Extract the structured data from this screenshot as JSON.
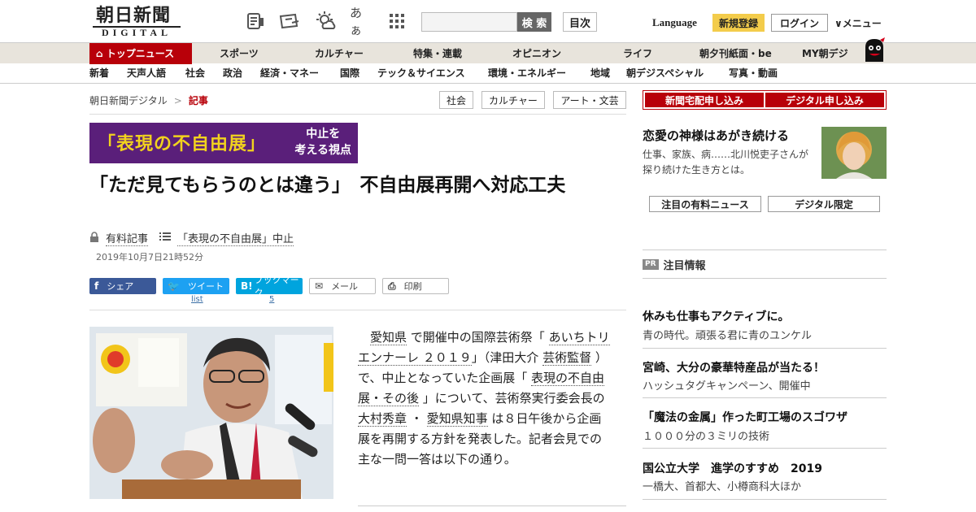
{
  "header": {
    "logo_main": "朝日新聞",
    "logo_sub": "DIGITAL",
    "icons": [
      "newspaper-icon",
      "tablet-icon",
      "weather-icon",
      "font-size-icon",
      "apps-grid-icon"
    ],
    "font_size_glyph": "あぁ",
    "search_placeholder": "",
    "search_button": "検 索",
    "toc_button": "目次",
    "language": "Language",
    "register": "新規登録",
    "login": "ログイン",
    "menu": "メニュー"
  },
  "nav_primary": [
    "トップニュース",
    "スポーツ",
    "カルチャー",
    "特集・連載",
    "オピニオン",
    "ライフ",
    "朝夕刊紙面・be",
    "MY朝デジ"
  ],
  "nav_secondary": [
    "新着",
    "天声人語",
    "社会",
    "政治",
    "経済・マネー",
    "国際",
    "テック＆サイエンス",
    "環境・エネルギー",
    "地域",
    "朝デジスペシャル",
    "写真・動画"
  ],
  "breadcrumb": {
    "home": "朝日新聞デジタル",
    "separator": ">",
    "current": "記事"
  },
  "tags": [
    "社会",
    "カルチャー",
    "アート・文芸"
  ],
  "banner": {
    "title": "「表現の不自由展」",
    "side": [
      "中止を",
      "考える視点"
    ]
  },
  "article": {
    "headline": "「ただ見てもらうのとは違う」　不自由展再開へ対応工夫",
    "paid": "有料記事",
    "series": "「表現の不自由展」中止",
    "date": "2019年10月7日21時52分",
    "body": [
      {
        "t": "愛知県",
        "link": true
      },
      {
        "t": " で開催中の国際芸術祭「 ",
        "link": false
      },
      {
        "t": "あいちトリエンナーレ ２０１９",
        "link": true
      },
      {
        "t": "」（津田大介 ",
        "link": false
      },
      {
        "t": "芸術監督",
        "link": true
      },
      {
        "t": " ）で、中止となっていた企画展「 ",
        "link": false
      },
      {
        "t": "表現の不自由展・その後",
        "link": true
      },
      {
        "t": " 」について、芸術祭実行委会長の ",
        "link": false
      },
      {
        "t": "大村秀章",
        "link": true
      },
      {
        "t": " ・ ",
        "link": false
      },
      {
        "t": "愛知県知事",
        "link": true
      },
      {
        "t": " は８日午後から企画展を再開する方針を発表した。記者会見での主な一問一答は以下の通り。",
        "link": false
      }
    ]
  },
  "share": {
    "facebook": "シェア",
    "twitter": "ツイート",
    "hatena": "ブックマーク",
    "mail": "メール",
    "print": "印刷",
    "twitter_count": "list",
    "hatena_count": "5"
  },
  "sidebar": {
    "subscribe": [
      "新聞宅配申し込み",
      "デジタル申し込み"
    ],
    "feature": {
      "title": "恋愛の神様はあがき続ける",
      "desc": "仕事、家族、病……北川悦吏子さんが探り続けた生き方とは。"
    },
    "tags": [
      "注目の有料ニュース",
      "デジタル限定"
    ],
    "pr_badge": "PR",
    "pr_heading": "注目情報",
    "pr_items": [
      {
        "title": "休みも仕事もアクティブに。",
        "sub": "青の時代。頑張る君に青のユンケル"
      },
      {
        "title": "宮崎、大分の豪華特産品が当たる！",
        "sub": "ハッシュタグキャンペーン、開催中"
      },
      {
        "title": "「魔法の金属」作った町工場のスゴワザ",
        "sub": "１０００分の３ミリの技術"
      },
      {
        "title": "国公立大学　進学のすすめ　2019",
        "sub": "一橋大、首都大、小樽商科大ほか"
      }
    ]
  },
  "colors": {
    "brand_red": "#b80009",
    "nav_bg": "#e8e4dc",
    "register_yellow": "#f3cc4b",
    "banner_purple": "#5a1f7a",
    "banner_yellow": "#f1d21e"
  }
}
